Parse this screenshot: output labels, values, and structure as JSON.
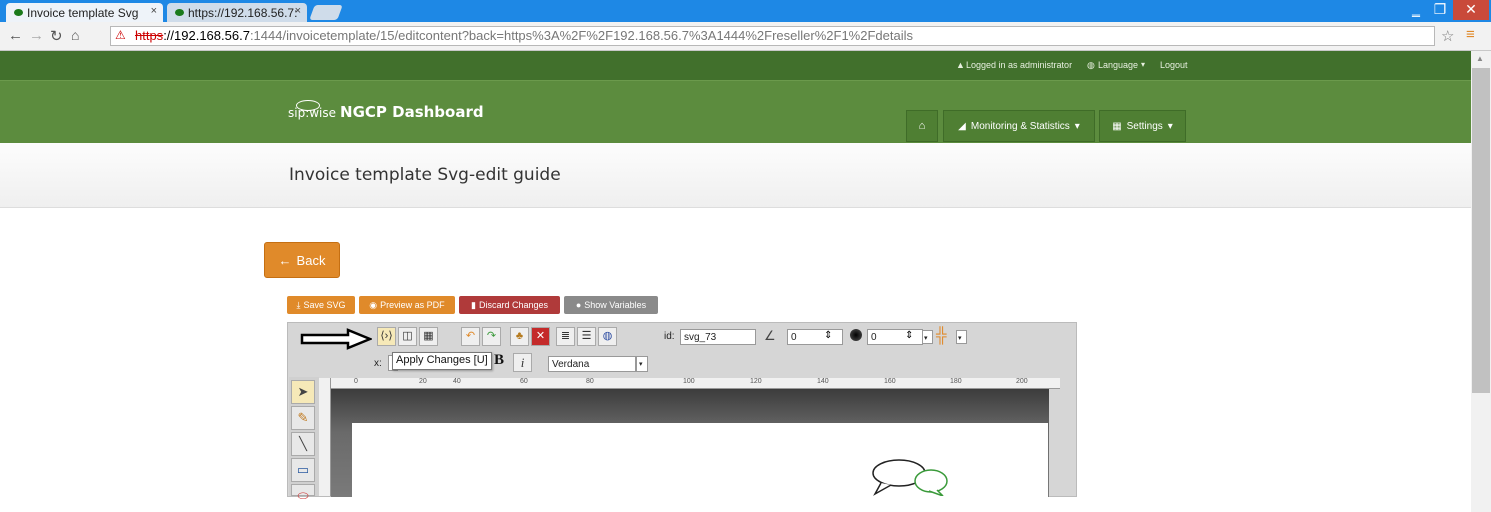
{
  "browser": {
    "tabs": [
      {
        "label": "Invoice template Svg"
      },
      {
        "label": "https://192.168.56.7:"
      }
    ],
    "url": {
      "scheme": "https",
      "host": "://192.168.56.7",
      "rest": ":1444/invoicetemplate/15/editcontent?back=https%3A%2F%2F192.168.56.7%3A1444%2Freseller%2F1%2Fdetails"
    }
  },
  "topbar": {
    "logged_in": "Logged in as administrator",
    "language": "Language",
    "logout": "Logout"
  },
  "header": {
    "brand": "sip:wise",
    "title": "NGCP Dashboard",
    "nav": {
      "monitoring": "Monitoring & Statistics",
      "settings": "Settings"
    }
  },
  "page": {
    "title": "Invoice template Svg-edit guide",
    "back": "Back"
  },
  "actions": {
    "save": "Save SVG",
    "preview": "Preview as PDF",
    "discard": "Discard Changes",
    "variables": "Show Variables"
  },
  "editor": {
    "id_label": "id:",
    "id_value": "svg_73",
    "angle_value": "0",
    "blur_value": "0",
    "x_label": "x:",
    "font_value": "Verdana",
    "bold": "B",
    "italic": "i",
    "tooltip": "Apply Changes [U]",
    "ruler": [
      "20",
      "40",
      "60",
      "80",
      "100",
      "120",
      "140",
      "160",
      "180",
      "200"
    ],
    "ruler_left": "0"
  },
  "colors": {
    "header": "#5c8c3e",
    "topbar": "#41702c",
    "back": "#e08a2a",
    "save": "#e08a2a",
    "discard": "#b03a3a",
    "variables": "#8a8a8a"
  }
}
